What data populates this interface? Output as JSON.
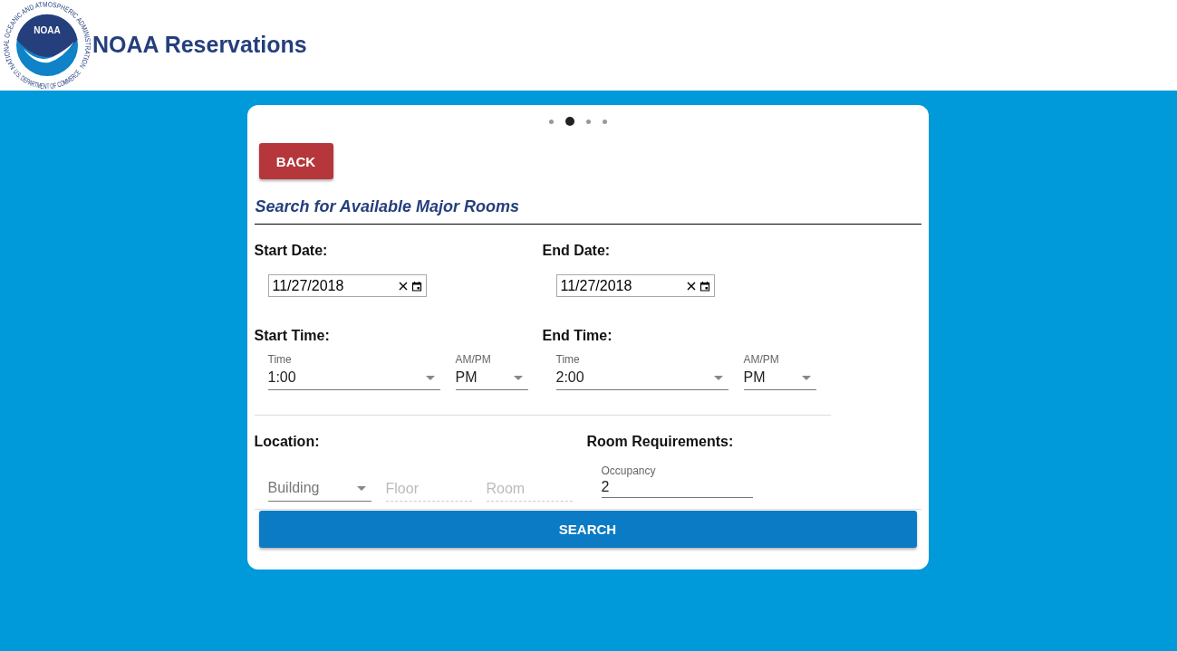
{
  "header": {
    "logo": {
      "ring_top": "NATIONAL OCEANIC AND ATMOSPHERIC ADMINISTRATION",
      "ring_bottom": "U.S. DEPARTMENT OF COMMERCE",
      "center": "NOAA"
    },
    "title": "NOAA Reservations"
  },
  "steps": [
    {
      "selected": false
    },
    {
      "selected": true
    },
    {
      "selected": false
    },
    {
      "selected": false
    }
  ],
  "back_button": "BACK",
  "heading": "Search for Available Major Rooms",
  "dates": [
    {
      "label": "Start Date:",
      "value": "11/27/2018"
    },
    {
      "label": "End Date:",
      "value": "11/27/2018"
    }
  ],
  "times": [
    {
      "label": "Start Time:",
      "time_label": "Time",
      "time": "1:00",
      "ampm_label": "AM/PM",
      "ampm": "PM"
    },
    {
      "label": "End Time:",
      "time_label": "Time",
      "time": "2:00",
      "ampm_label": "AM/PM",
      "ampm": "PM"
    }
  ],
  "location": {
    "label": "Location:",
    "fields": [
      {
        "kind": "select",
        "placeholder": "Building",
        "disabled": false
      },
      {
        "kind": "text",
        "placeholder": "Floor",
        "disabled": true
      },
      {
        "kind": "text",
        "placeholder": "Room",
        "disabled": true
      }
    ]
  },
  "requirements": {
    "label": "Room Requirements:",
    "occupancy_label": "Occupancy",
    "occupancy": "2"
  },
  "search_button": "SEARCH"
}
